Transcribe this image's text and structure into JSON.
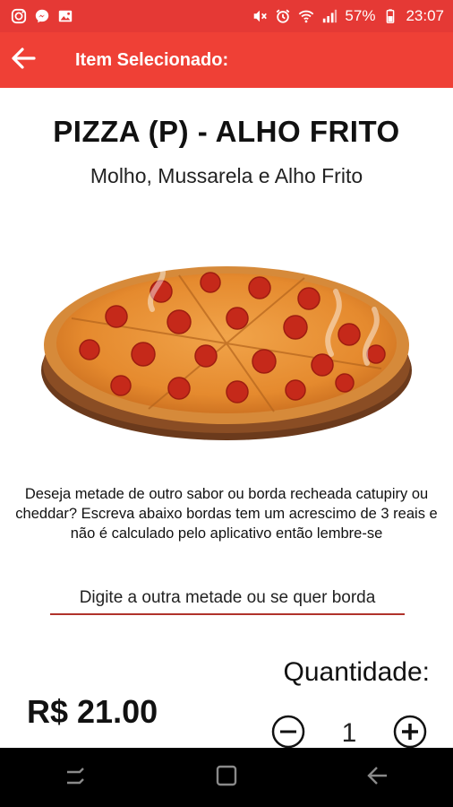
{
  "status_bar": {
    "battery": "57%",
    "time": "23:07",
    "left_icons": [
      "instagram-icon",
      "messenger-icon",
      "gallery-icon"
    ],
    "right_icons": [
      "mute-icon",
      "alarm-icon",
      "wifi-icon",
      "signal-icon",
      "battery-icon"
    ]
  },
  "app_bar": {
    "title": "Item Selecionado:",
    "back_icon": "arrow-back-icon",
    "color": "#ef4036"
  },
  "item": {
    "name": "PIZZA (P) - ALHO FRITO",
    "description": "Molho, Mussarela e Alho Frito",
    "image": "pizza-image"
  },
  "notice": "Deseja metade de outro sabor ou borda recheada catupiry ou cheddar? Escreva abaixo bordas tem um acrescimo de 3 reais e não é calculado pelo aplicativo então lembre-se",
  "half_field": {
    "placeholder": "Digite a outra metade ou se quer borda",
    "value": ""
  },
  "price": "R$ 21.00",
  "quantity": {
    "label": "Quantidade:",
    "value": "1",
    "decrement_icon": "minus-circle-icon",
    "increment_icon": "plus-circle-icon"
  },
  "nav_bar": [
    "recents-icon",
    "home-icon",
    "back-icon"
  ]
}
